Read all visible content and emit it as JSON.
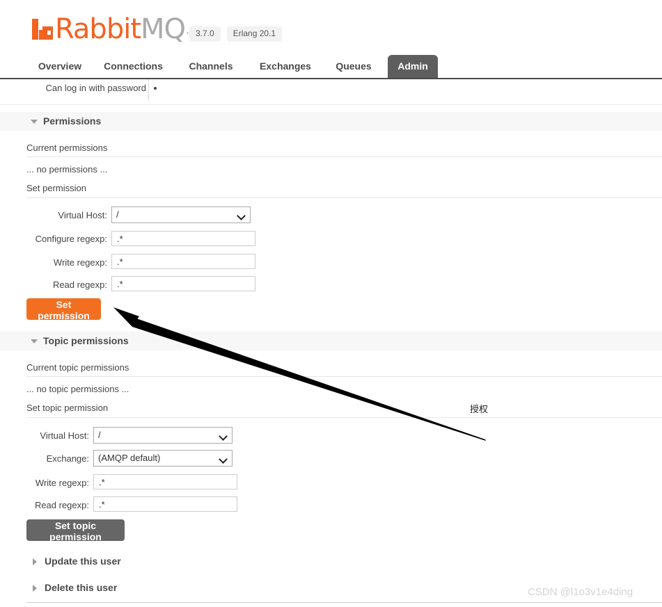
{
  "app": {
    "brand_rabbit": "Rabbit",
    "brand_mq": "MQ",
    "brand_tm": "™",
    "version_badge": "3.7.0",
    "erlang_badge": "Erlang 20.1",
    "accent_color": "#f26322",
    "active_tab_color": "#5e5e5e"
  },
  "nav": {
    "tabs": [
      {
        "label": "Overview",
        "active": false
      },
      {
        "label": "Connections",
        "active": false
      },
      {
        "label": "Channels",
        "active": false
      },
      {
        "label": "Exchanges",
        "active": false
      },
      {
        "label": "Queues",
        "active": false
      },
      {
        "label": "Admin",
        "active": true
      }
    ]
  },
  "user_detail_row": {
    "label": "Can log in with password",
    "value": "•"
  },
  "permissions": {
    "section_title": "Permissions",
    "current_title": "Current permissions",
    "empty_text": "... no permissions ...",
    "set_title": "Set permission",
    "form": {
      "vhost_label": "Virtual Host:",
      "vhost_value": "/",
      "configure_label": "Configure regexp:",
      "configure_value": ".*",
      "write_label": "Write regexp:",
      "write_value": ".*",
      "read_label": "Read regexp:",
      "read_value": ".*"
    },
    "submit_label": "Set permission"
  },
  "topic_permissions": {
    "section_title": "Topic permissions",
    "current_title": "Current topic permissions",
    "empty_text": "... no topic permissions ...",
    "set_title": "Set topic permission",
    "form": {
      "vhost_label": "Virtual Host:",
      "vhost_value": "/",
      "exchange_label": "Exchange:",
      "exchange_value": "(AMQP default)",
      "write_label": "Write regexp:",
      "write_value": ".*",
      "read_label": "Read regexp:",
      "read_value": ".*"
    },
    "submit_label": "Set topic permission"
  },
  "collapsed_sections": [
    {
      "label": "Update this user"
    },
    {
      "label": "Delete this user"
    }
  ],
  "annotation": {
    "text": "授权"
  },
  "watermark": {
    "text": "CSDN @l1o3v1e4ding"
  }
}
